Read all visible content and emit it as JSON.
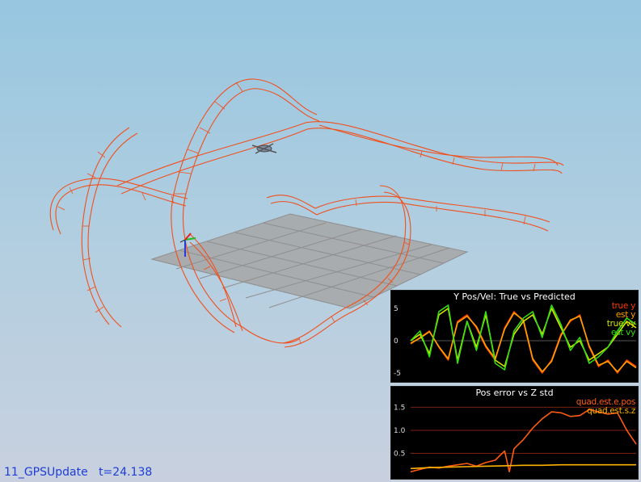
{
  "status": {
    "scenario": "11_GPSUpdate",
    "time_label": "t=24.138"
  },
  "colors": {
    "trajectory": "#f0501e",
    "ground": "#a8a8a8",
    "plot_bg": "#000000",
    "status_text": "#1e3cd8"
  },
  "chart_data": [
    {
      "type": "line",
      "title": "Y Pos/Vel: True vs Predicted",
      "ylim": [
        -6,
        6
      ],
      "yticks": [
        5,
        0,
        -5
      ],
      "xlim": [
        0,
        24
      ],
      "grid": false,
      "legend_position": "top-right",
      "series": [
        {
          "name": "true y",
          "color": "#ff3a00",
          "x": [
            0,
            1,
            2,
            3,
            4,
            5,
            6,
            7,
            8,
            9,
            10,
            11,
            12,
            13,
            14,
            15,
            16,
            17,
            18,
            19,
            20,
            21,
            22,
            23,
            24
          ],
          "values": [
            -0.5,
            0.5,
            1.5,
            -1,
            -3,
            3,
            4,
            2,
            -1,
            -3,
            2,
            4.5,
            3,
            -3,
            -5,
            -3,
            1,
            3,
            4,
            -1,
            -4,
            -3,
            -5,
            -3,
            -4
          ]
        },
        {
          "name": "est y",
          "color": "#ffa000",
          "x": [
            0,
            1,
            2,
            3,
            4,
            5,
            6,
            7,
            8,
            9,
            10,
            11,
            12,
            13,
            14,
            15,
            16,
            17,
            18,
            19,
            20,
            21,
            22,
            23,
            24
          ],
          "values": [
            -0.4,
            0.4,
            1.4,
            -0.9,
            -2.8,
            2.8,
            3.8,
            2.2,
            -0.8,
            -2.8,
            1.8,
            4.3,
            3.2,
            -2.8,
            -4.8,
            -3.2,
            0.8,
            3.2,
            3.8,
            -0.8,
            -3.8,
            -3.2,
            -4.8,
            -3.2,
            -4.2
          ]
        },
        {
          "name": "true vy",
          "color": "#d8e800",
          "x": [
            0,
            1,
            2,
            3,
            4,
            5,
            6,
            7,
            8,
            9,
            10,
            11,
            12,
            13,
            14,
            15,
            16,
            17,
            18,
            19,
            20,
            21,
            22,
            23,
            24
          ],
          "values": [
            0,
            1,
            -2,
            4,
            5,
            -3,
            3,
            -1,
            4,
            -3,
            -4,
            1,
            3,
            4,
            1,
            5,
            2,
            -1,
            0,
            -3,
            -2,
            -1,
            1,
            3,
            2
          ]
        },
        {
          "name": "est vy",
          "color": "#33dd11",
          "x": [
            0,
            1,
            2,
            3,
            4,
            5,
            6,
            7,
            8,
            9,
            10,
            11,
            12,
            13,
            14,
            15,
            16,
            17,
            18,
            19,
            20,
            21,
            22,
            23,
            24
          ],
          "values": [
            0,
            1.5,
            -2.5,
            4.5,
            5.5,
            -3.5,
            3,
            -1.5,
            4.5,
            -3.5,
            -4.5,
            1.5,
            3.5,
            4.5,
            0.5,
            5.5,
            2.5,
            -1.5,
            0.5,
            -3.5,
            -2.5,
            -1,
            1.5,
            3.5,
            2.5
          ]
        }
      ]
    },
    {
      "type": "line",
      "title": "Pos error vs Z std",
      "ylim": [
        0,
        1.7
      ],
      "yticks": [
        1.5,
        1.0,
        0.5
      ],
      "xlim": [
        0,
        24
      ],
      "grid": true,
      "legend_position": "top-right",
      "series": [
        {
          "name": "quad.est.e.pos",
          "color": "#ff5a14",
          "x": [
            0,
            1,
            2,
            3,
            4,
            5,
            6,
            7,
            8,
            9,
            10,
            10.5,
            11,
            12,
            13,
            14,
            15,
            16,
            17,
            18,
            19,
            20,
            21,
            22,
            23,
            24
          ],
          "values": [
            0.1,
            0.15,
            0.2,
            0.18,
            0.22,
            0.25,
            0.28,
            0.22,
            0.3,
            0.35,
            0.55,
            0.1,
            0.6,
            0.8,
            1.05,
            1.25,
            1.4,
            1.38,
            1.3,
            1.32,
            1.45,
            1.4,
            1.35,
            1.38,
            1.0,
            0.7
          ]
        },
        {
          "name": "quad.est.s.z",
          "color": "#ffb300",
          "x": [
            0,
            2,
            4,
            6,
            8,
            10,
            12,
            14,
            16,
            18,
            20,
            22,
            24
          ],
          "values": [
            0.17,
            0.19,
            0.2,
            0.21,
            0.22,
            0.23,
            0.24,
            0.24,
            0.25,
            0.25,
            0.25,
            0.25,
            0.25
          ]
        }
      ]
    }
  ]
}
